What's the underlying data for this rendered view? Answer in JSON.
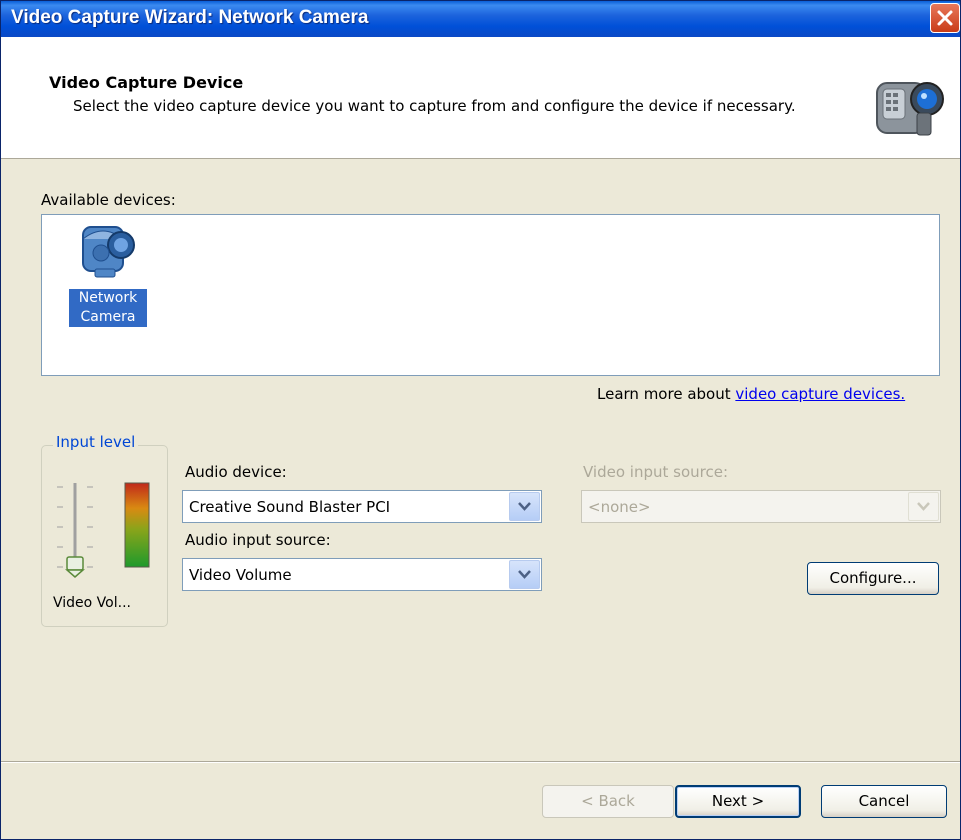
{
  "window": {
    "title": "Video Capture Wizard: Network Camera",
    "close_icon": "close-icon"
  },
  "header": {
    "title": "Video Capture Device",
    "subtitle": "Select the video capture device you want to capture from and configure the device if necessary.",
    "icon": "camcorder-icon"
  },
  "devices": {
    "label": "Available devices:",
    "items": [
      {
        "label_line1": "Network",
        "label_line2": "Camera",
        "icon": "network-camera-icon",
        "selected": true
      }
    ]
  },
  "learn_more": {
    "prefix": "Learn more about ",
    "link": "video capture devices."
  },
  "input_level": {
    "legend": "Input level",
    "footer": "Video Vol..."
  },
  "audio_device": {
    "label": "Audio device:",
    "value": "Creative Sound Blaster PCI"
  },
  "audio_input_source": {
    "label": "Audio input source:",
    "value": "Video Volume"
  },
  "video_input_source": {
    "label": "Video input source:",
    "value": "<none>",
    "enabled": false
  },
  "buttons": {
    "configure": "Configure...",
    "back": "< Back",
    "next": "Next >",
    "cancel": "Cancel"
  },
  "colors": {
    "title_bar": "#0050d8",
    "selection": "#316ac5",
    "link": "#0000ee",
    "legend": "#0046d5"
  }
}
